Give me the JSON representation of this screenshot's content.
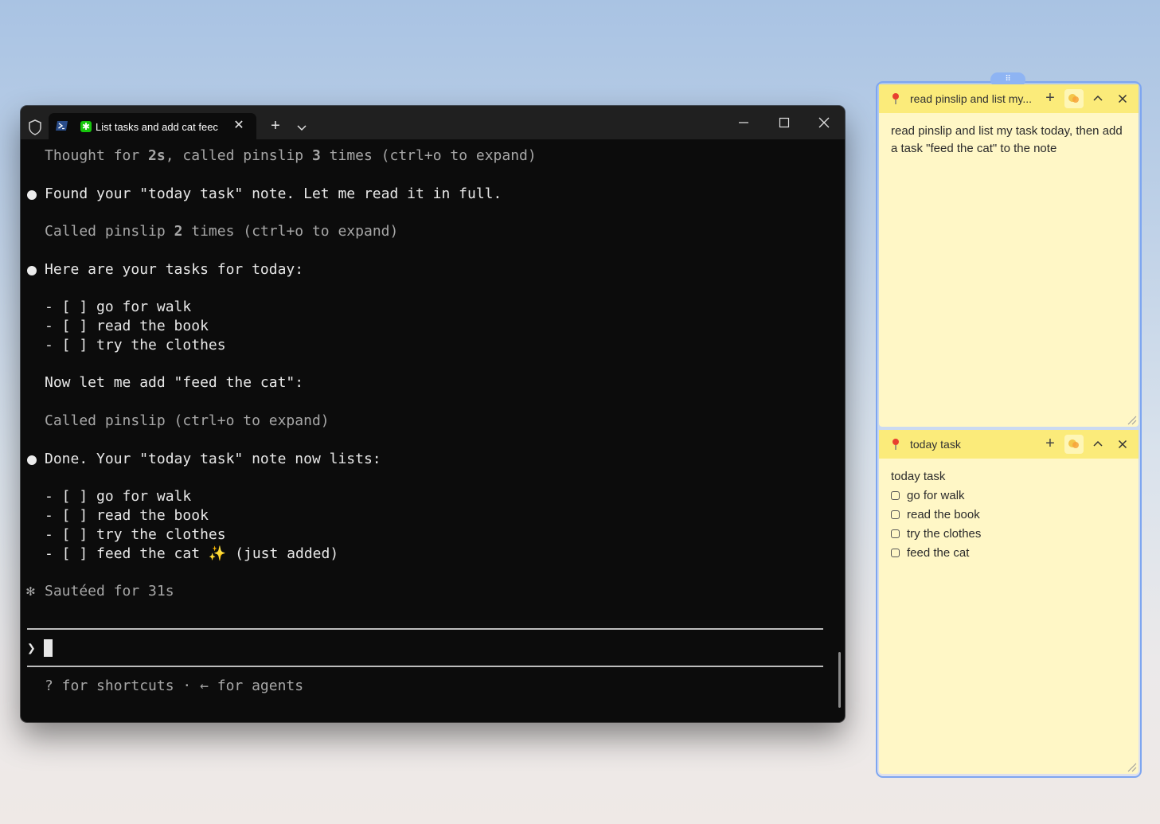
{
  "terminal": {
    "tab_title": "List tasks and add cat feec",
    "tab_close_glyph": "✕",
    "new_tab_glyph": "+",
    "app_icon": "powershell-icon",
    "agent_icon": "claude-icon",
    "agent_icon_glyph": "✱",
    "lines": {
      "thought_pre": "Thought for ",
      "thought_bold": "2s",
      "thought_mid": ", called pinslip ",
      "thought_bold2": "3",
      "thought_post": " times (ctrl+o to expand)",
      "found": "Found your \"today task\" note. Let me read it in full.",
      "called_pre": "Called pinslip ",
      "called_bold": "2",
      "called_post": " times (ctrl+o to expand)",
      "here": "Here are your tasks for today:",
      "now": "Now let me add \"feed the cat\":",
      "called_one": "Called pinslip (ctrl+o to expand)",
      "done": "Done. Your \"today task\" note now lists:",
      "sauteed_mark": "✻",
      "sauteed": "Sautéed for 31s"
    },
    "list_before": [
      "- [ ] go for walk",
      "- [ ] read the book",
      "- [ ] try the clothes"
    ],
    "list_after": [
      "- [ ] go for walk",
      "- [ ] read the book",
      "- [ ] try the clothes",
      "- [ ] feed the cat ✨ (just added)"
    ],
    "prompt_symbol": "❯",
    "footer": "? for shortcuts · ← for agents"
  },
  "notes": {
    "handle_glyph": "⠿",
    "note1": {
      "title": "read pinslip and list my...",
      "plus_glyph": "+",
      "body": "read pinslip and list my task today, then add a task \"feed the cat\" to the note"
    },
    "note2": {
      "title": "today task",
      "plus_glyph": "+",
      "heading": "today task",
      "tasks": [
        "go for walk",
        "read the book",
        "try the clothes",
        "feed the cat"
      ]
    }
  },
  "colors": {
    "terminal_bg": "#0c0c0c",
    "titlebar_bg": "#202020",
    "note_header": "#fbeb7a",
    "note_body": "#fff7c6",
    "frame_accent": "#7ea6f0"
  }
}
